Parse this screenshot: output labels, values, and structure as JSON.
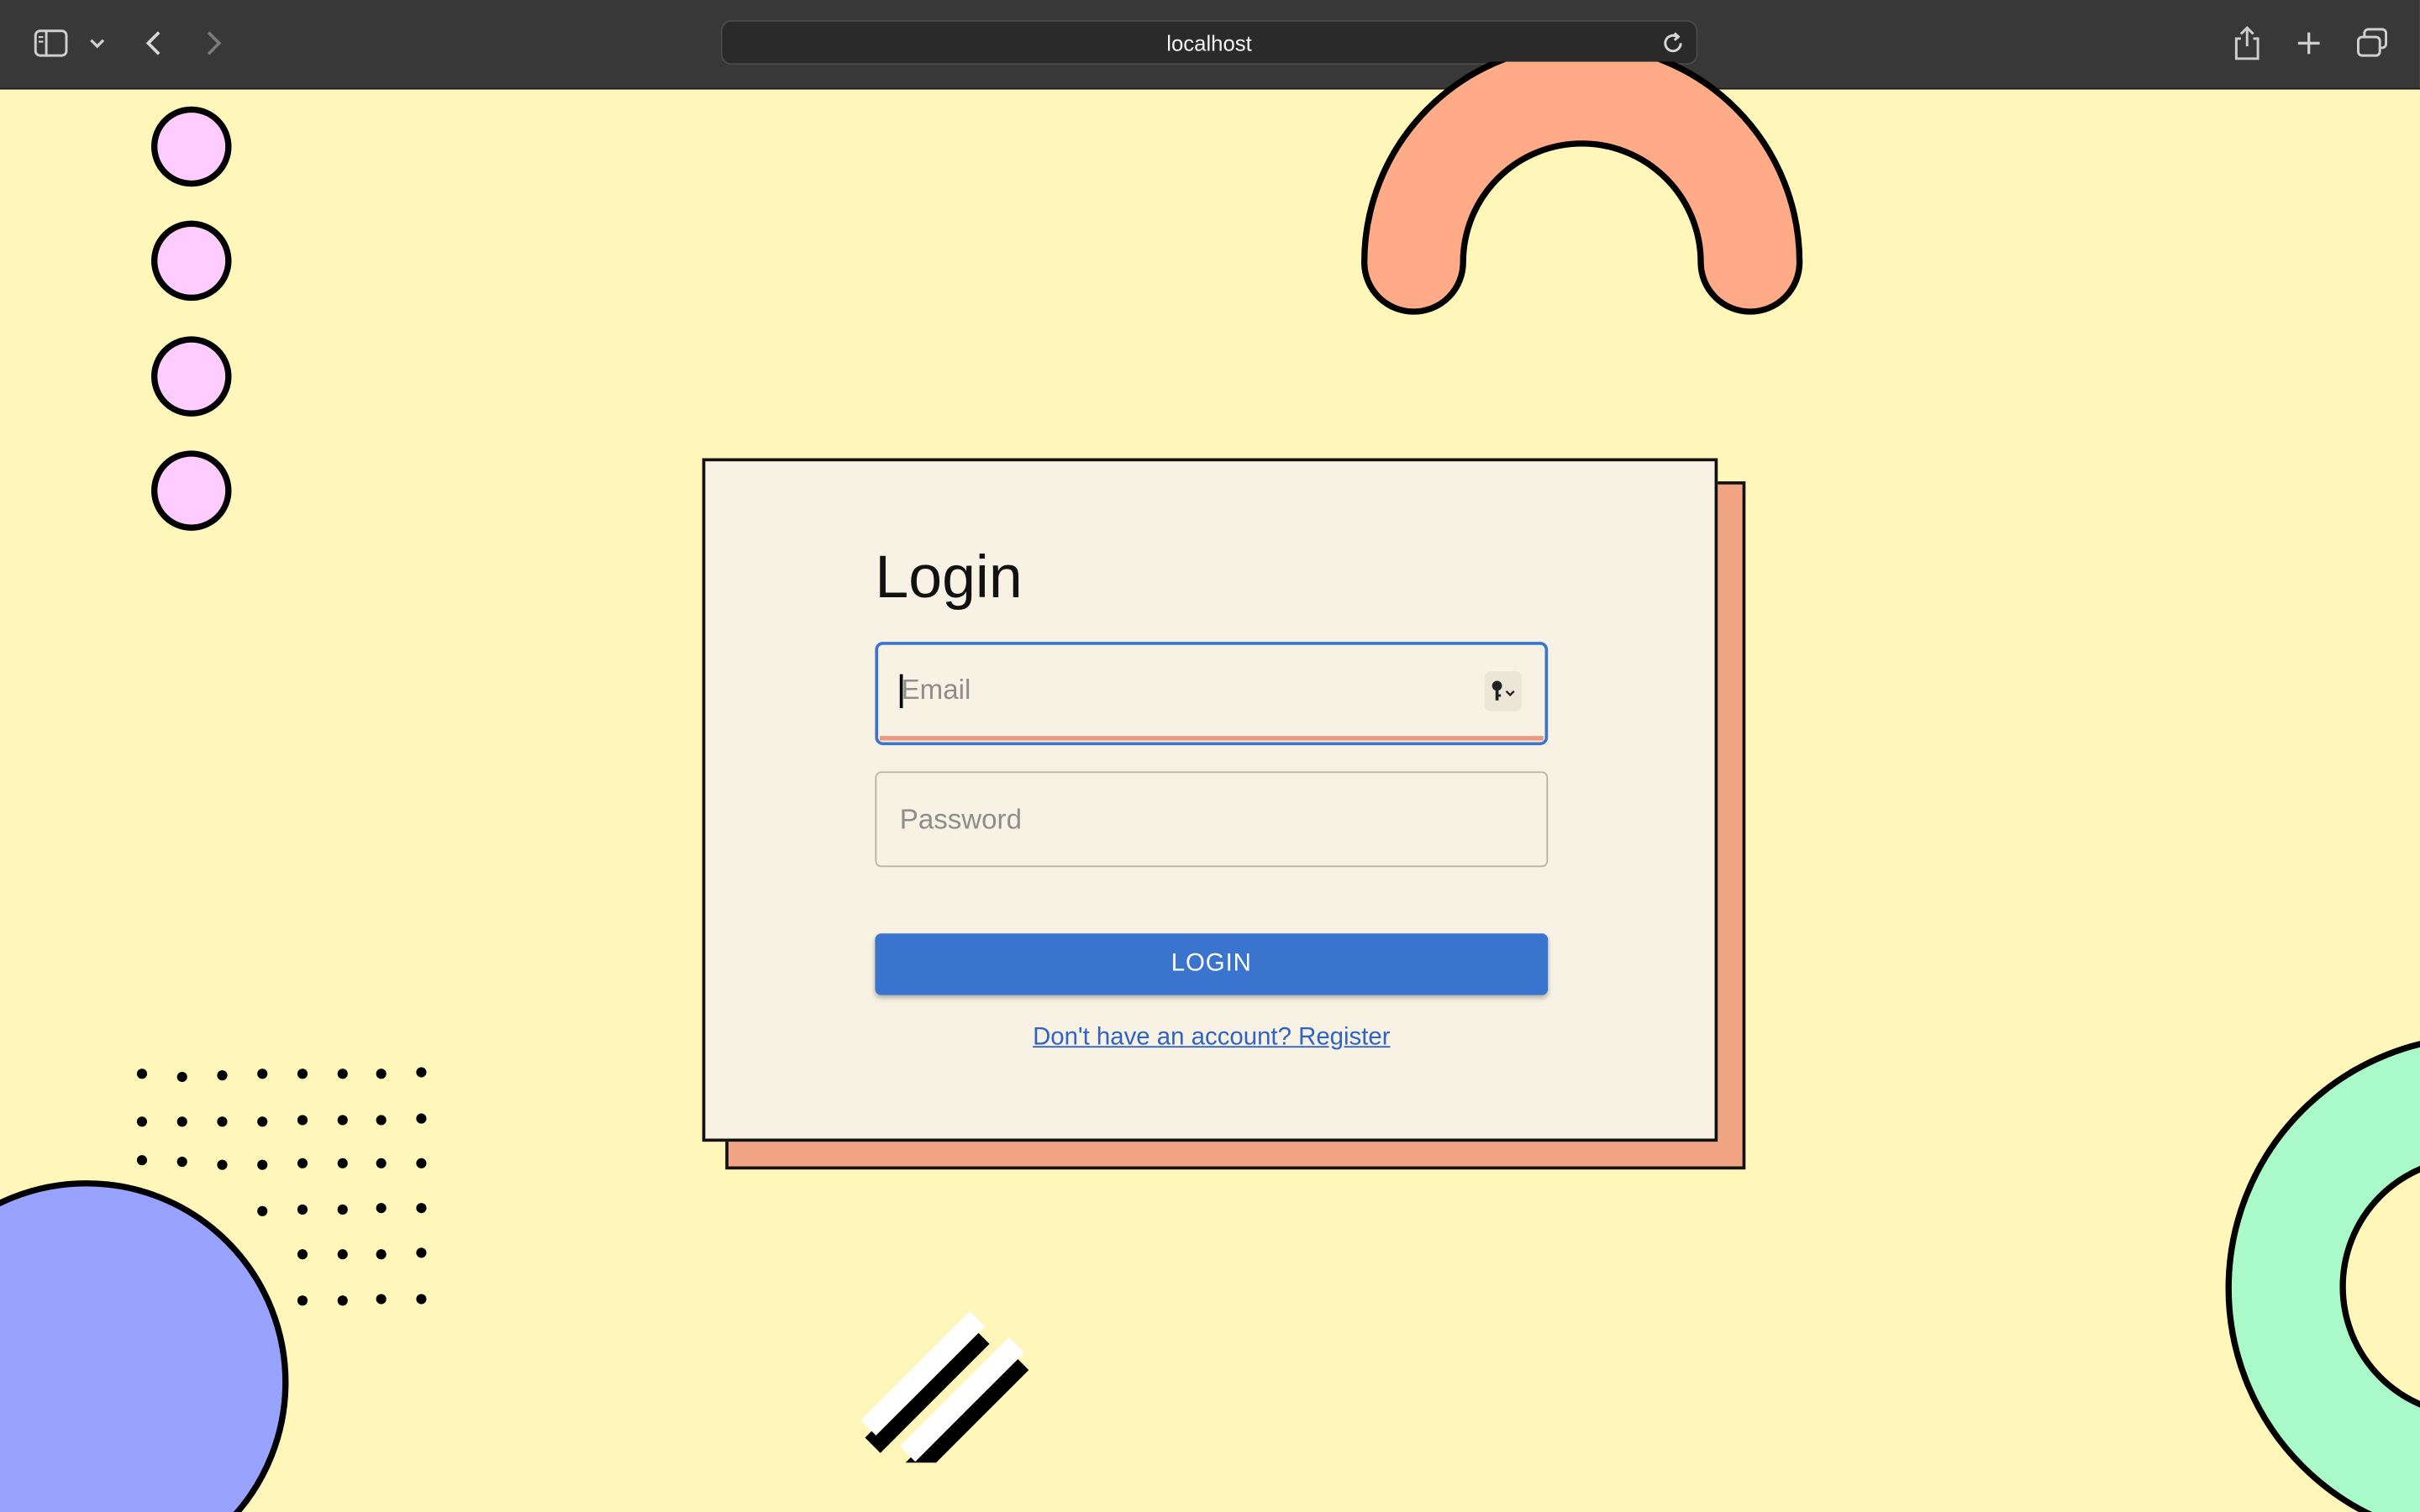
{
  "browser": {
    "url": "localhost",
    "icons": {
      "sidebar": "sidebar-icon",
      "chevron": "chevron-down-icon",
      "back": "back-arrow-icon",
      "forward": "forward-arrow-icon",
      "reload": "reload-icon",
      "share": "share-icon",
      "new_tab": "plus-icon",
      "tabs": "tab-overview-icon"
    }
  },
  "login": {
    "title": "Login",
    "email_placeholder": "Email",
    "password_placeholder": "Password",
    "button_label": "LOGIN",
    "register_link": "Don't have an account? Register"
  },
  "colors": {
    "background": "#fff7b9",
    "card": "#f7f2e3",
    "card_shadow": "#f1a585",
    "accent_blue": "#3a74cf",
    "circle_pink": "#ffccff",
    "arch_orange": "#ffab88",
    "circle_blue": "#97a3ff",
    "ring_green": "#aaf9c9"
  }
}
